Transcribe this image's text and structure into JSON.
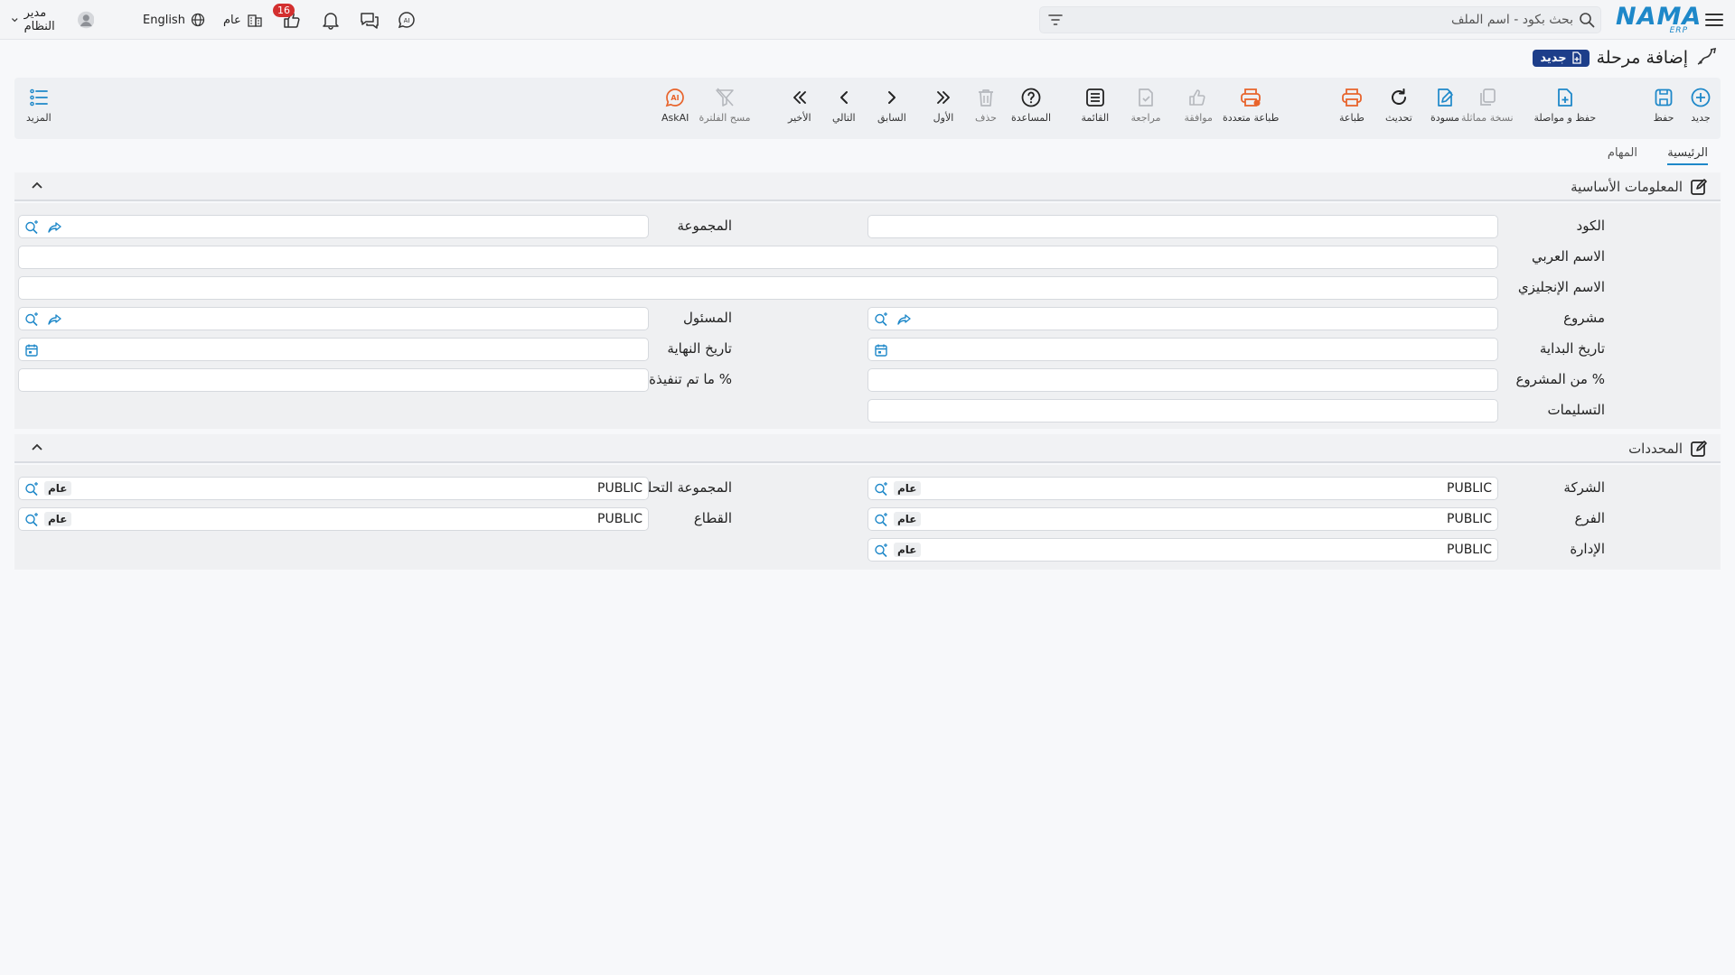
{
  "topbar": {
    "logo_text": "NAMA",
    "logo_sub": "ERP",
    "search_placeholder": "بحث بكود - اسم الملف",
    "user_name": "مدير النظام",
    "language": "English",
    "scope": "عام",
    "notification_count": "16"
  },
  "page": {
    "title": "إضافة مرحلة",
    "mode_badge": "جديد"
  },
  "toolbar": {
    "new": "جديد",
    "save": "حفظ",
    "save_continue": "حفظ و مواصلة",
    "duplicate": "نسخة مماثلة",
    "draft": "مسودة",
    "refresh": "تحديث",
    "print": "طباعة",
    "multi_print": "طباعة متعددة",
    "approve": "موافقة",
    "review": "مراجعة",
    "list": "القائمة",
    "help": "المساعدة",
    "delete": "حذف",
    "first": "الأول",
    "previous": "السابق",
    "next": "التالي",
    "last": "الأخير",
    "clear_filter": "مسح الفلترة",
    "askai": "AskAI",
    "more": "المزيد"
  },
  "tabs": [
    {
      "label": "الرئيسية"
    },
    {
      "label": "المهام"
    }
  ],
  "sections": {
    "basic": {
      "title": "المعلومات الأساسية",
      "fields": {
        "code": {
          "label": "الكود",
          "value": ""
        },
        "group": {
          "label": "المجموعة",
          "value": ""
        },
        "arabic_name": {
          "label": "الاسم العربي",
          "value": ""
        },
        "english_name": {
          "label": "الاسم الإنجليزي",
          "value": ""
        },
        "project": {
          "label": "مشروع",
          "value": ""
        },
        "responsible": {
          "label": "المسئول",
          "value": ""
        },
        "start_date": {
          "label": "تاريخ البداية",
          "value": ""
        },
        "end_date": {
          "label": "تاريخ النهاية",
          "value": ""
        },
        "project_percent": {
          "label": "% من المشروع",
          "value": ""
        },
        "done_percent": {
          "label": "% ما تم تنفيذة",
          "value": ""
        },
        "deliverables": {
          "label": "التسليمات",
          "value": ""
        }
      }
    },
    "dimensions": {
      "title": "المحددات",
      "fields": {
        "company": {
          "label": "الشركة",
          "value": "PUBLIC",
          "badge": "عام"
        },
        "analytic_group": {
          "label": "المجموعة التحليلية",
          "value": "PUBLIC",
          "badge": "عام"
        },
        "branch": {
          "label": "الفرع",
          "value": "PUBLIC",
          "badge": "عام"
        },
        "sector": {
          "label": "القطاع",
          "value": "PUBLIC",
          "badge": "عام"
        },
        "department": {
          "label": "الإدارة",
          "value": "PUBLIC",
          "badge": "عام"
        }
      }
    }
  },
  "colors": {
    "accent": "#1e88c9",
    "orange": "#e8642c",
    "badge_red": "#d32f2f",
    "new_badge": "#1d3e8a"
  }
}
